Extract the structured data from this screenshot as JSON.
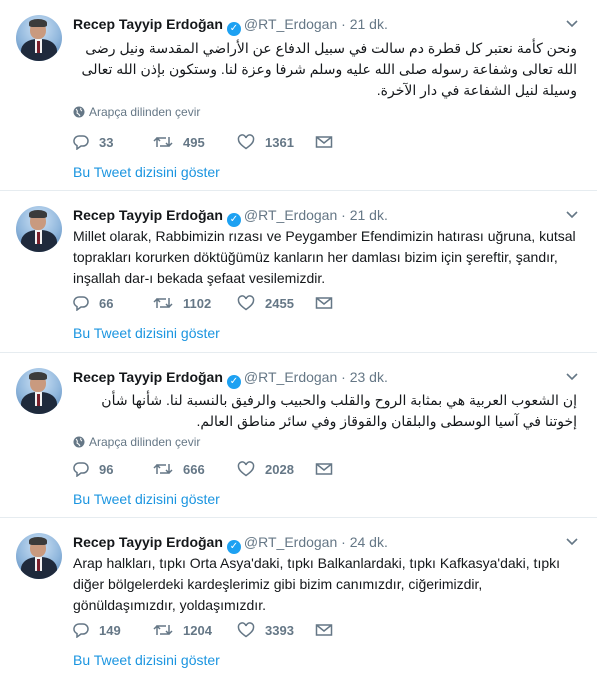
{
  "tweets": [
    {
      "name": "Recep Tayyip Erdoğan",
      "handle": "@RT_Erdogan",
      "dot": "·",
      "time": "21 dk.",
      "text": "ونحن كأمة نعتبر كل قطرة دم سالت في سبيل الدفاع عن الأراضي المقدسة ونيل رضى الله تعالى وشفاعة رسوله صلى الله عليه وسلم شرفا وعزة لنا. وستكون بإذن الله تعالى وسيلة لنيل الشفاعة في دار الآخرة.",
      "translate": "Arapça dilinden çevir",
      "replies": "33",
      "retweets": "495",
      "likes": "1361",
      "show_thread": "Bu Tweet dizisini göster"
    },
    {
      "name": "Recep Tayyip Erdoğan",
      "handle": "@RT_Erdogan",
      "dot": "·",
      "time": "21 dk.",
      "text": "Millet olarak, Rabbimizin rızası ve Peygamber Efendimizin hatırası uğruna, kutsal toprakları korurken döktüğümüz kanların her damlası bizim için şereftir, şandır, inşallah dar-ı bekada şefaat vesilemizdir.",
      "replies": "66",
      "retweets": "1102",
      "likes": "2455",
      "show_thread": "Bu Tweet dizisini göster"
    },
    {
      "name": "Recep Tayyip Erdoğan",
      "handle": "@RT_Erdogan",
      "dot": "·",
      "time": "23 dk.",
      "text": "إن الشعوب العربية هي بمثابة الروح والقلب والحبيب والرفيق بالنسبة لنا. شأنها شأن إخوتنا في آسيا الوسطى والبلقان والقوقاز وفي سائر مناطق العالم.",
      "translate": "Arapça dilinden çevir",
      "replies": "96",
      "retweets": "666",
      "likes": "2028",
      "show_thread": "Bu Tweet dizisini göster"
    },
    {
      "name": "Recep Tayyip Erdoğan",
      "handle": "@RT_Erdogan",
      "dot": "·",
      "time": "24 dk.",
      "text": "Arap halkları, tıpkı Orta Asya'daki, tıpkı Balkanlardaki, tıpkı Kafkasya'daki, tıpkı diğer bölgelerdeki kardeşlerimiz gibi bizim canımızdır, ciğerimizdir, gönüldaşımızdır, yoldaşımızdır.",
      "replies": "149",
      "retweets": "1204",
      "likes": "3393",
      "show_thread": "Bu Tweet dizisini göster"
    }
  ],
  "colors": {
    "link": "#1b95e0",
    "verified": "#1da1f2",
    "muted": "#657786",
    "divider": "#e6ecf0"
  }
}
